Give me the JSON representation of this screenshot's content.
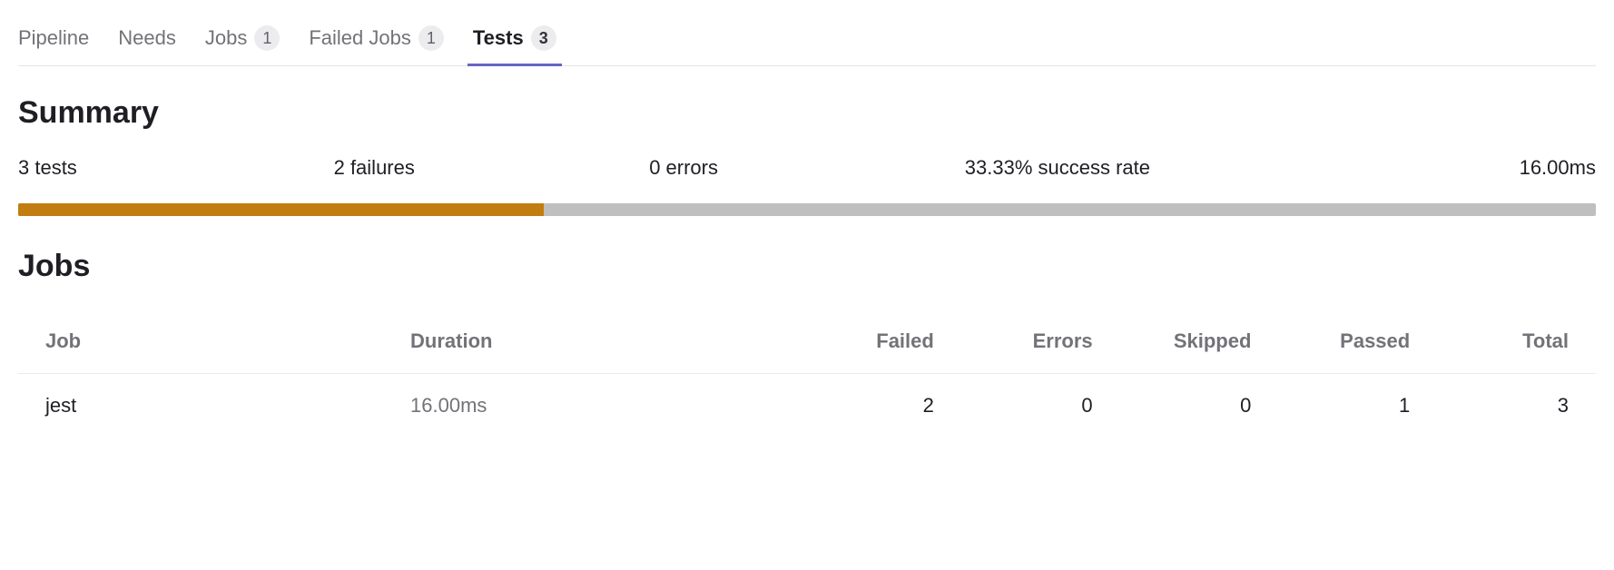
{
  "tabs": [
    {
      "label": "Pipeline",
      "badge": null,
      "active": false
    },
    {
      "label": "Needs",
      "badge": null,
      "active": false
    },
    {
      "label": "Jobs",
      "badge": "1",
      "active": false
    },
    {
      "label": "Failed Jobs",
      "badge": "1",
      "active": false
    },
    {
      "label": "Tests",
      "badge": "3",
      "active": true
    }
  ],
  "summary": {
    "heading": "Summary",
    "tests": "3 tests",
    "failures": "2 failures",
    "errors": "0 errors",
    "success_rate": "33.33% success rate",
    "duration": "16.00ms",
    "progress_orange_pct": 33.33
  },
  "jobs": {
    "heading": "Jobs",
    "columns": {
      "job": "Job",
      "duration": "Duration",
      "failed": "Failed",
      "errors": "Errors",
      "skipped": "Skipped",
      "passed": "Passed",
      "total": "Total"
    },
    "rows": [
      {
        "job": "jest",
        "duration": "16.00ms",
        "failed": "2",
        "errors": "0",
        "skipped": "0",
        "passed": "1",
        "total": "3"
      }
    ]
  }
}
